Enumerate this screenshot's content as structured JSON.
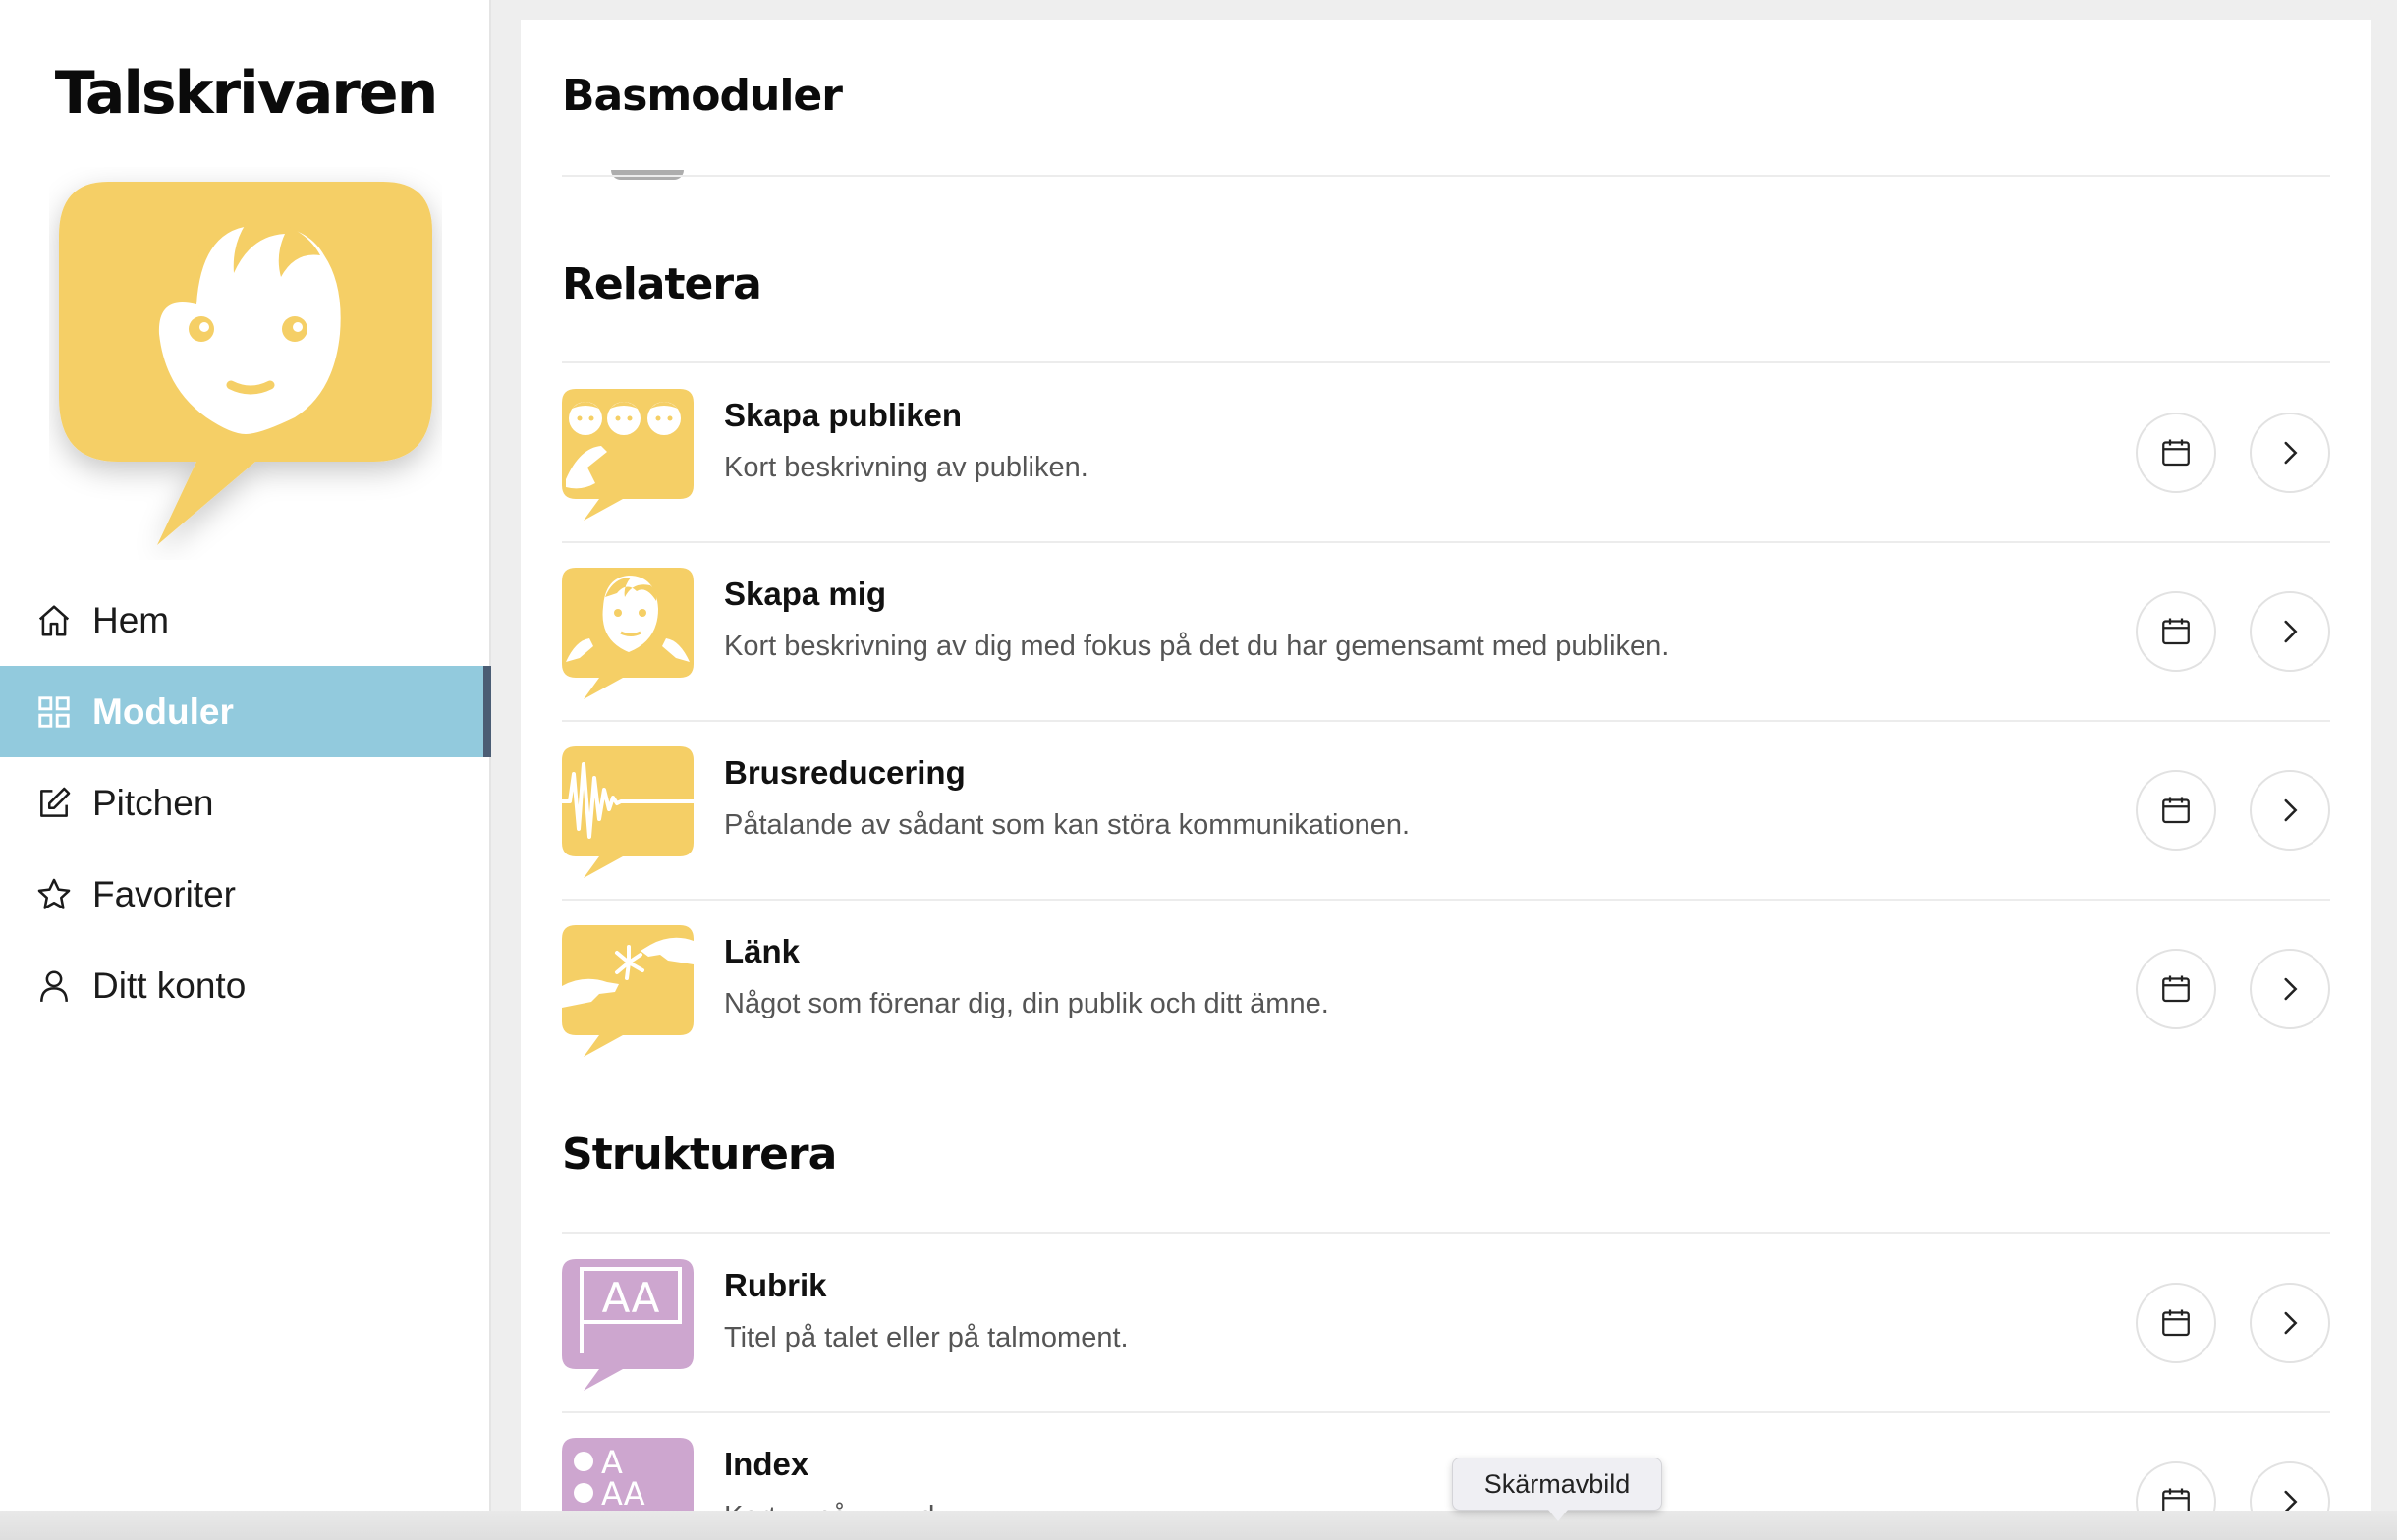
{
  "brand": {
    "name": "Talskrivaren"
  },
  "nav": {
    "items": [
      {
        "label": "Hem",
        "icon": "home-icon"
      },
      {
        "label": "Moduler",
        "icon": "grid-icon",
        "active": true
      },
      {
        "label": "Pitchen",
        "icon": "edit-icon"
      },
      {
        "label": "Favoriter",
        "icon": "star-icon"
      },
      {
        "label": "Ditt konto",
        "icon": "user-icon"
      }
    ]
  },
  "colors": {
    "accent_active": "#92cadd",
    "active_marker": "#4b5d74",
    "yellow": "#f5cf66",
    "purple": "#cda6cf"
  },
  "sections": {
    "basmoduler": {
      "title": "Basmoduler"
    },
    "relatera": {
      "title": "Relatera",
      "items": [
        {
          "title": "Skapa publiken",
          "desc": "Kort beskrivning av publiken.",
          "icon": "audience-icon"
        },
        {
          "title": "Skapa mig",
          "desc": "Kort beskrivning av dig med fokus på det du har gemensamt med publiken.",
          "icon": "self-icon"
        },
        {
          "title": "Brusreducering",
          "desc": "Påtalande av sådant som kan störa kommunikationen.",
          "icon": "noise-icon"
        },
        {
          "title": "Länk",
          "desc": "Något som förenar dig, din publik och ditt ämne.",
          "icon": "link-icon"
        }
      ]
    },
    "strukturera": {
      "title": "Strukturera",
      "items": [
        {
          "title": "Rubrik",
          "desc": "Titel på talet eller på talmoment.",
          "icon": "heading-icon"
        },
        {
          "title": "Index",
          "desc": "Kort ... på ... ... d... ...",
          "icon": "index-icon"
        }
      ]
    }
  },
  "tooltip": {
    "text": "Skärmavbild"
  }
}
